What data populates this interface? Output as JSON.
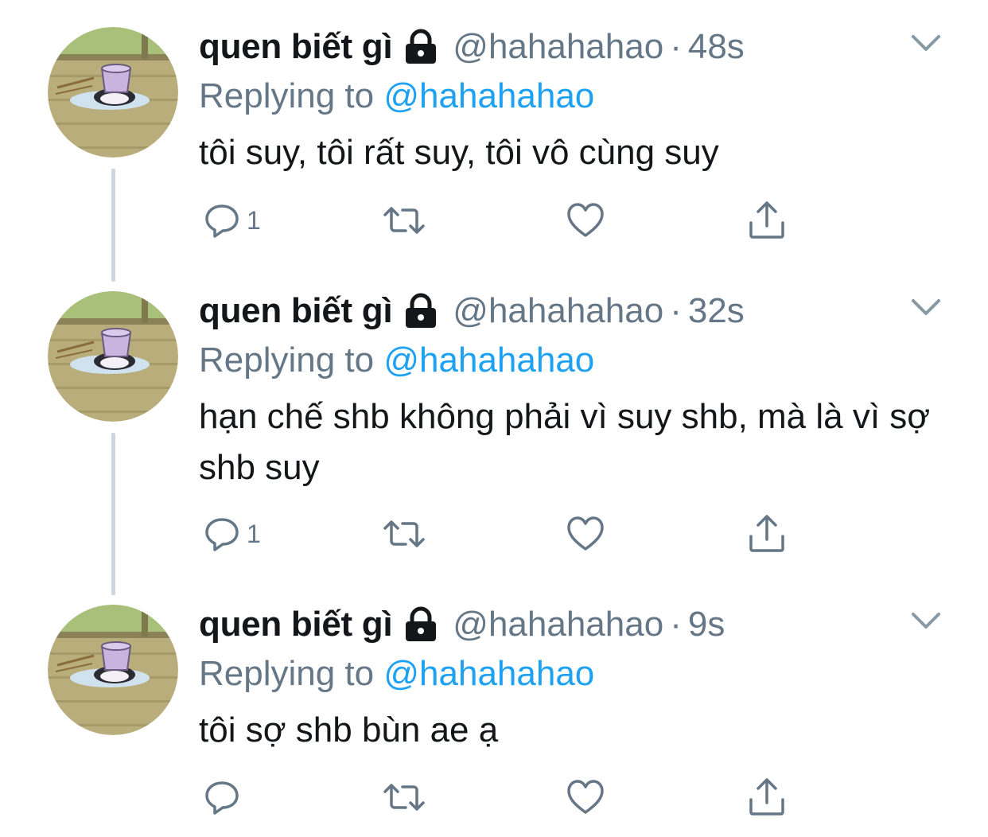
{
  "tweets": [
    {
      "display_name": "quen biết gì",
      "handle": "@hahahahao",
      "separator": "·",
      "time": "48s",
      "replying_prefix": "Replying to ",
      "replying_to": "@hahahahao",
      "text": "tôi suy, tôi rất suy, tôi vô cùng suy",
      "reply_count": "1"
    },
    {
      "display_name": "quen biết gì",
      "handle": "@hahahahao",
      "separator": "·",
      "time": "32s",
      "replying_prefix": "Replying to ",
      "replying_to": "@hahahahao",
      "text": "hạn chế shb không phải vì suy shb, mà là vì sợ shb suy",
      "reply_count": "1"
    },
    {
      "display_name": "quen biết gì",
      "handle": "@hahahahao",
      "separator": "·",
      "time": "9s",
      "replying_prefix": "Replying to ",
      "replying_to": "@hahahahao",
      "text": "tôi sợ shb bùn ae ạ",
      "reply_count": ""
    }
  ],
  "icons": {
    "lock": "lock-icon",
    "more": "chevron-down-icon",
    "reply": "reply-icon",
    "retweet": "retweet-icon",
    "like": "heart-icon",
    "share": "share-icon"
  },
  "colors": {
    "text": "#14171a",
    "secondary": "#657786",
    "mention": "#1da1f2",
    "thread_line": "#cdd6df"
  }
}
